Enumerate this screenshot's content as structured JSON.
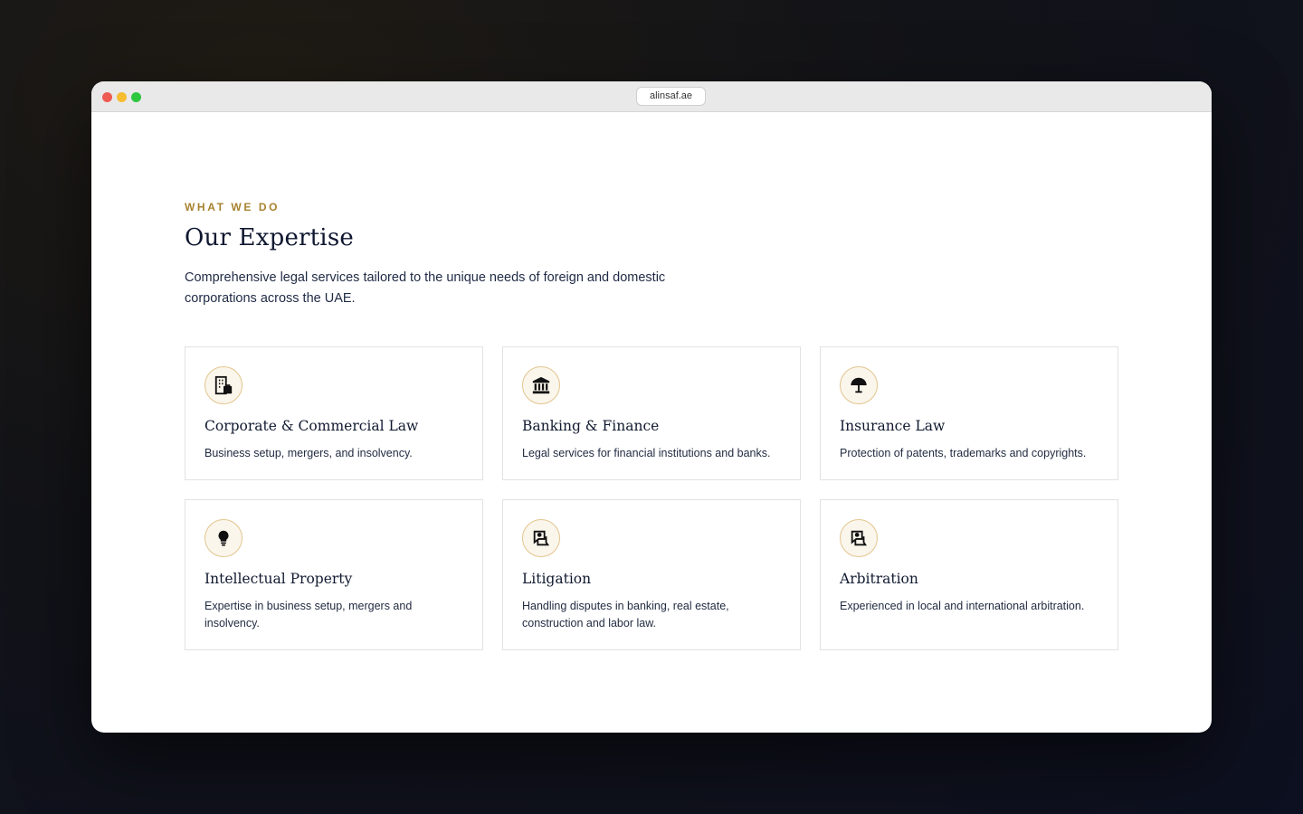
{
  "browser": {
    "url": "alinsaf.ae"
  },
  "colors": {
    "accent": "#a8832f",
    "close": "#ee5b52",
    "minimize": "#f5bd2f",
    "maximize": "#2ec740"
  },
  "section": {
    "eyebrow": "WHAT WE DO",
    "title": "Our Expertise",
    "lead": "Comprehensive legal services tailored to the unique needs of foreign and domestic corporations across the UAE."
  },
  "services": [
    {
      "icon": "building-icon",
      "title": "Corporate & Commercial Law",
      "desc": "Business setup, mergers, and insolvency."
    },
    {
      "icon": "bank-icon",
      "title": "Banking & Finance",
      "desc": "Legal services for financial institutions and banks."
    },
    {
      "icon": "umbrella-icon",
      "title": "Insurance Law",
      "desc": "Protection of patents, trademarks and copyrights."
    },
    {
      "icon": "lightbulb-icon",
      "title": "Intellectual Property",
      "desc": "Expertise in business setup, mergers and insolvency."
    },
    {
      "icon": "legal-document-icon",
      "title": "Litigation",
      "desc": "Handling disputes in banking, real estate, construction and labor law."
    },
    {
      "icon": "legal-document-icon",
      "title": "Arbitration",
      "desc": "Experienced in local and international arbitration."
    }
  ]
}
